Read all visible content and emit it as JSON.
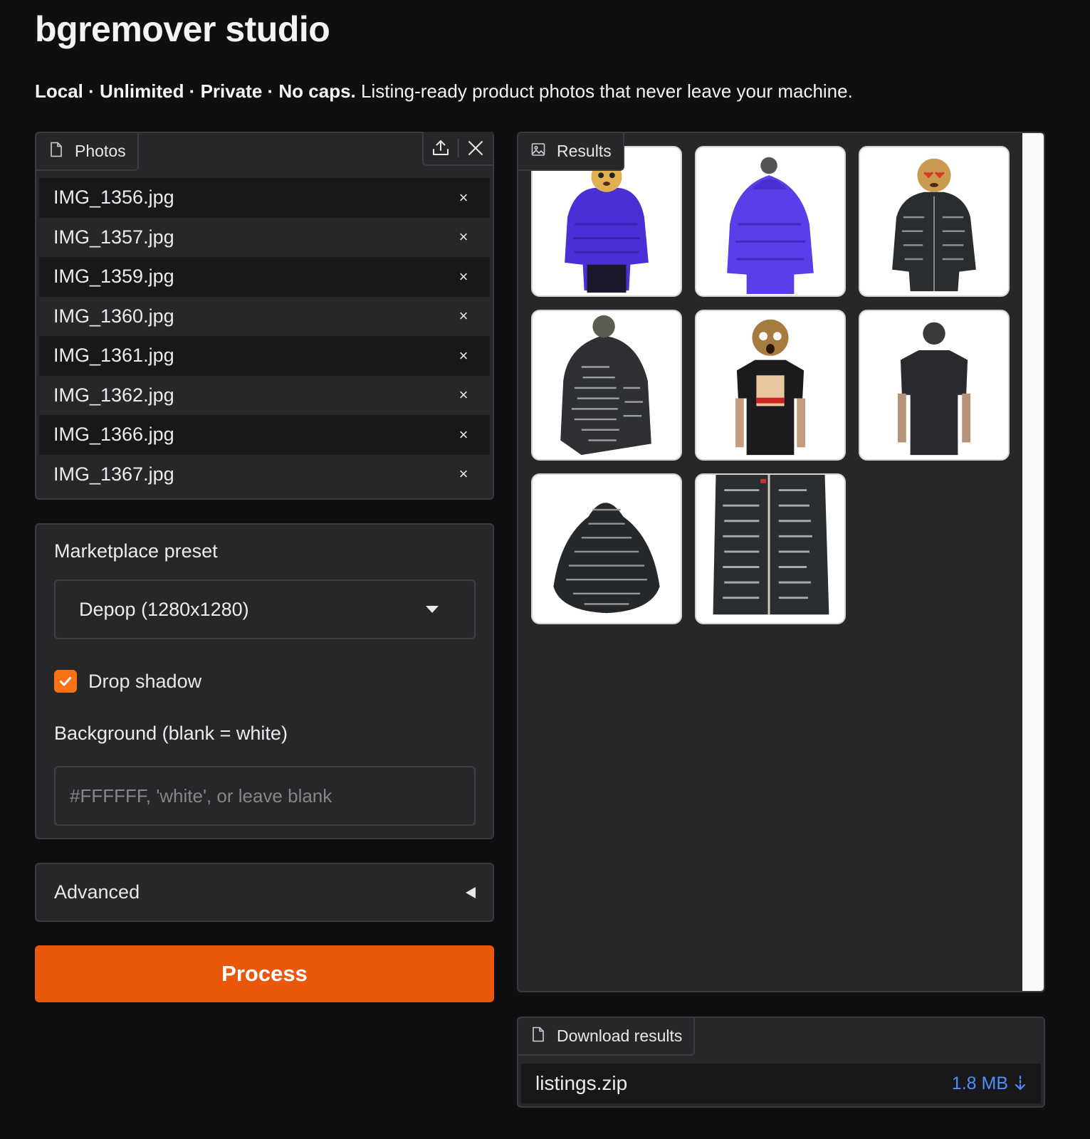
{
  "app": {
    "title": "bgremover studio",
    "tagline_bold": "Local · Unlimited · Private · No caps.",
    "tagline_rest": " Listing-ready product photos that never leave your machine."
  },
  "photos": {
    "label": "Photos",
    "icon": "file-icon",
    "files": [
      {
        "name": "IMG_1356.jpg"
      },
      {
        "name": "IMG_1357.jpg"
      },
      {
        "name": "IMG_1359.jpg"
      },
      {
        "name": "IMG_1360.jpg"
      },
      {
        "name": "IMG_1361.jpg"
      },
      {
        "name": "IMG_1362.jpg"
      },
      {
        "name": "IMG_1366.jpg"
      },
      {
        "name": "IMG_1367.jpg"
      }
    ],
    "remove_glyph": "×"
  },
  "settings": {
    "preset_label": "Marketplace preset",
    "preset_value": "Depop (1280x1280)",
    "shadow_label": "Drop shadow",
    "shadow_checked": true,
    "background_label": "Background (blank = white)",
    "background_value": "",
    "background_placeholder": "#FFFFFF, 'white', or leave blank"
  },
  "advanced": {
    "label": "Advanced",
    "expanded": false
  },
  "process": {
    "label": "Process"
  },
  "results": {
    "label": "Results",
    "icon": "image-icon",
    "thumbnails": [
      {
        "desc": "purple puffer jacket front"
      },
      {
        "desc": "purple puffer jacket back"
      },
      {
        "desc": "black printed zip hoodie front"
      },
      {
        "desc": "black printed hoodie side"
      },
      {
        "desc": "black graphic t-shirt front"
      },
      {
        "desc": "black t-shirt back"
      },
      {
        "desc": "black printed hoodie flat lay"
      },
      {
        "desc": "black printed zip hoodie closeup"
      }
    ]
  },
  "download": {
    "label": "Download results",
    "file_name": "listings.zip",
    "file_size": "1.8 MB"
  },
  "colors": {
    "accent": "#ea580c",
    "checkbox": "#f97316",
    "link": "#4f8ff7",
    "background": "#0f0f11",
    "panel": "#27272a"
  }
}
